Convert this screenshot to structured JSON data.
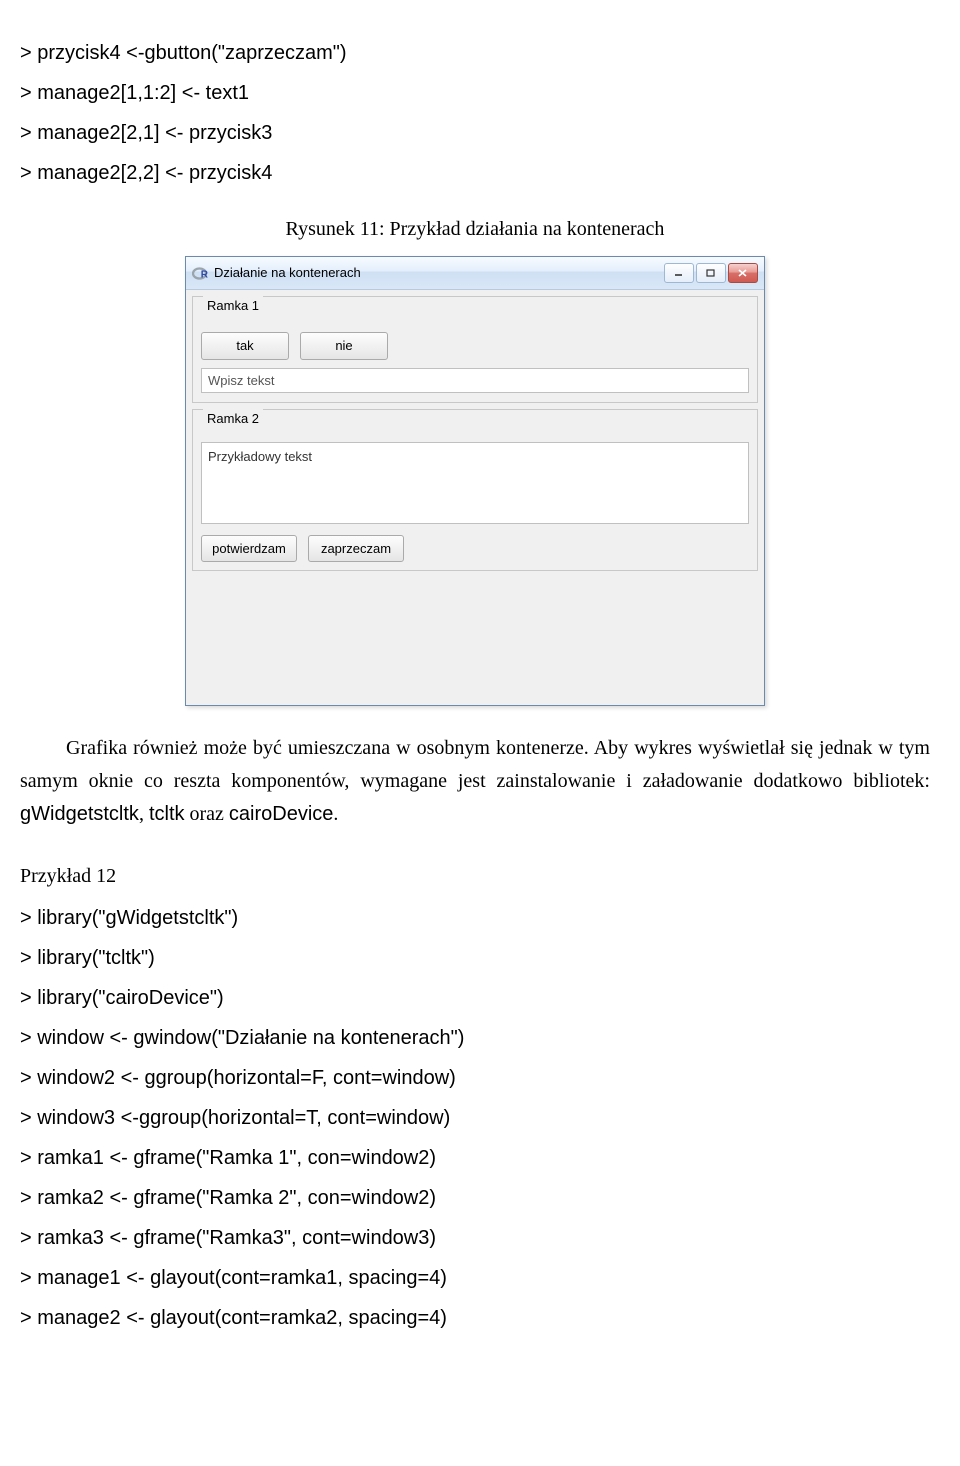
{
  "code1": {
    "l1": "> przycisk4 <-gbutton(\"zaprzeczam\")",
    "l2": "> manage2[1,1:2] <- text1",
    "l3": "> manage2[2,1] <- przycisk3",
    "l4": "> manage2[2,2] <- przycisk4"
  },
  "figureCaption": "Rysunek 11: Przykład działania na kontenerach",
  "window": {
    "title": "Działanie na kontenerach",
    "iconLetter": "R",
    "ramka1": {
      "legend": "Ramka 1",
      "btn_tak": "tak",
      "btn_nie": "nie",
      "input_value": "Wpisz tekst"
    },
    "ramka2": {
      "legend": "Ramka 2",
      "list_text": "Przykładowy tekst",
      "btn_potwierdzam": "potwierdzam",
      "btn_zaprzeczam": "zaprzeczam"
    }
  },
  "para_before": "Grafika również może być umieszczana w osobnym kontenerze. Aby wykres wyświetlał się jednak w tym samym oknie co reszta komponentów, wymagane jest zainstalowanie i załadowanie dodatkowo bibliotek: ",
  "para_lib1": "gWidgetstcltk",
  "para_mid1": ", ",
  "para_lib2": "tcltk",
  "para_mid2": " oraz ",
  "para_lib3": "cairoDevice",
  "para_end": ".",
  "exampleLabel": "Przykład 12",
  "code2": {
    "l1": ">  library(\"gWidgetstcltk\")",
    "l2": ">  library(\"tcltk\")",
    "l3": ">  library(\"cairoDevice\")",
    "l4": ">  window <- gwindow(\"Działanie na kontenerach\")",
    "l5": ">  window2 <- ggroup(horizontal=F, cont=window)",
    "l6": ">  window3 <-ggroup(horizontal=T, cont=window)",
    "l7": ">   ramka1 <- gframe(\"Ramka 1\", con=window2)",
    "l8": ">   ramka2 <- gframe(\"Ramka 2\", con=window2)",
    "l9": ">   ramka3 <- gframe(\"Ramka3\", cont=window3)",
    "l10": ">    manage1 <- glayout(cont=ramka1, spacing=4)",
    "l11": ">    manage2 <- glayout(cont=ramka2, spacing=4)"
  }
}
